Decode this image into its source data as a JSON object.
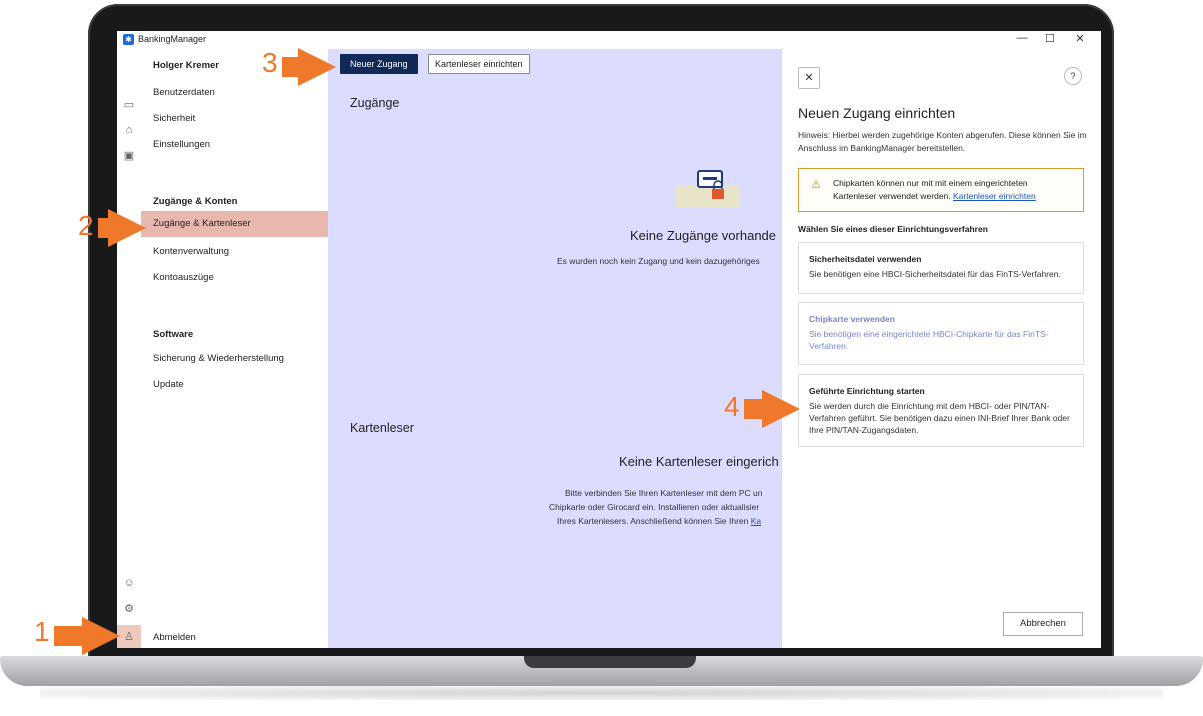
{
  "window": {
    "app_title": "BankingManager",
    "minimize": "—",
    "maximize": "☐",
    "close": "✕"
  },
  "sidebar": {
    "user_name": "Holger Kremer",
    "items_top": [
      "Benutzerdaten",
      "Sicherheit",
      "Einstellungen"
    ],
    "section_accounts": "Zugänge & Konten",
    "items_accounts": [
      "Zugänge & Kartenleser",
      "Kontenverwaltung",
      "Kontoauszüge"
    ],
    "section_software": "Software",
    "items_software": [
      "Sicherung & Wiederherstellung",
      "Update"
    ],
    "logout": "Abmelden"
  },
  "main": {
    "new_access_button": "Neuer Zugang",
    "setup_reader_button": "Kartenleser einrichten",
    "access_section_title": "Zugänge",
    "access_empty_title": "Keine Zugänge vorhande",
    "access_empty_text": "Es wurden noch kein Zugang und kein dazugehöriges",
    "reader_section_title": "Kartenleser",
    "reader_empty_title": "Keine Kartenleser eingerich",
    "reader_empty_line1": "Bitte verbinden Sie Ihren Kartenleser mit dem PC un",
    "reader_empty_line2": "Chipkarte oder Girocard ein. Installieren oder aktualisier",
    "reader_empty_line3": "Ihres Kartenlesers. Anschließend können Sie Ihren ",
    "reader_empty_link": "Ka"
  },
  "panel": {
    "close": "✕",
    "help": "?",
    "title": "Neuen Zugang einrichten",
    "hint": "Hinweis: Hierbei werden zugehörige Konten abgerufen. Diese können Sie im Anschluss im BankingManager bereitstellen.",
    "warning_text": "Chipkarten können nur mit mit einem eingerichteten Kartenleser verwendet werden. ",
    "warning_link": "Kartenleser einrichten",
    "choose_label": "Wählen Sie eines dieser Einrichtungsverfahren",
    "options": [
      {
        "title": "Sicherheitsdatei verwenden",
        "desc": "Sie benötigen eine HBCI-Sicherheitsdatei für das FinTS-Verfahren."
      },
      {
        "title": "Chipkarte verwenden",
        "desc": "Sie benötigen eine eingerichtete HBCI-Chipkarte für das FinTS-Verfahren."
      },
      {
        "title": "Geführte Einrichtung starten",
        "desc": "Sie werden durch die Einrichtung mit dem HBCI- oder PIN/TAN-Verfahren geführt. Sie benötigen dazu einen INI-Brief Ihrer Bank oder Ihre PIN/TAN-Zugangsdaten."
      }
    ],
    "cancel_button": "Abbrechen"
  },
  "markers": [
    "1",
    "2",
    "3",
    "4"
  ],
  "colors": {
    "accent_orange": "#f0782a",
    "primary_navy": "#0f2a56",
    "main_background": "#dcdcff",
    "selected_item": "#e8b8ae",
    "link_blue": "#1a56c4"
  }
}
